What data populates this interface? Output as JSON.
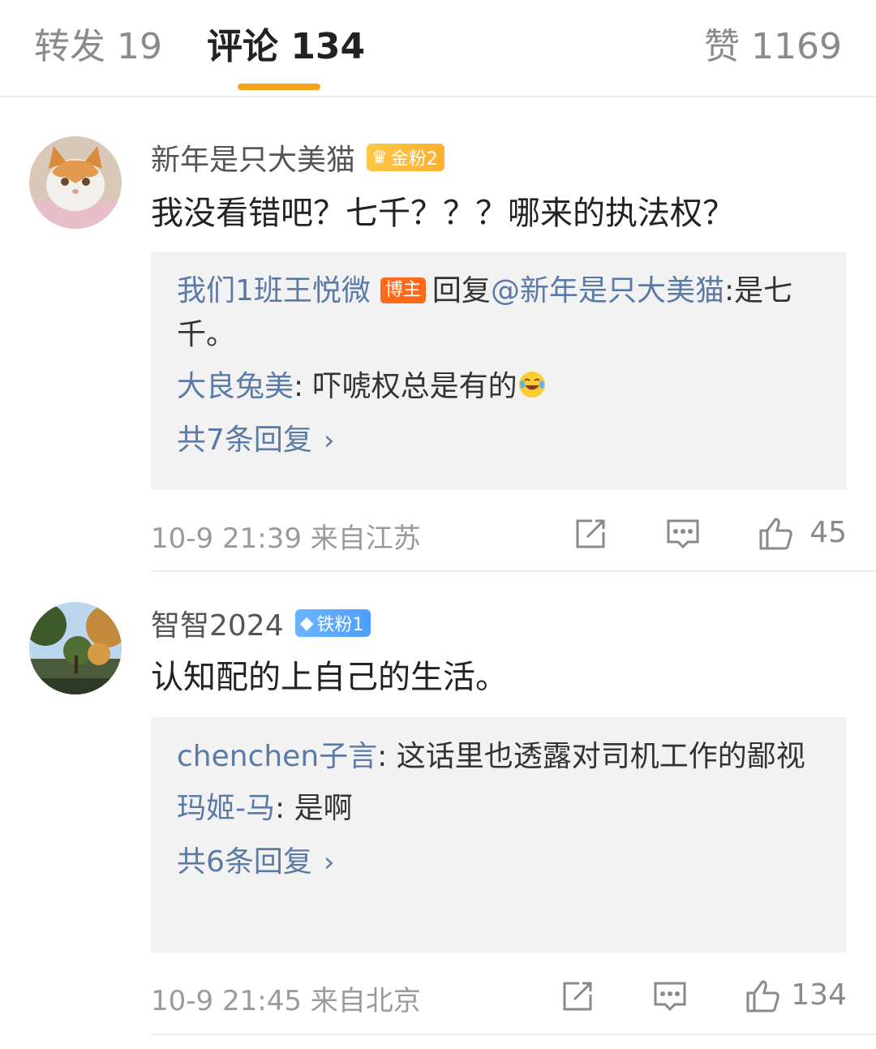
{
  "tabs": {
    "repost": "转发 19",
    "comment": "评论 134",
    "like": "赞 1169"
  },
  "comments": [
    {
      "username": "新年是只大美猫",
      "badge": "金粉2",
      "badge_icon": "crown-icon",
      "text": "我没看错吧？七千？？？哪来的执法权？",
      "replies": [
        {
          "name": "我们1班王悦微",
          "owner_badge": "博主",
          "reply_word": "回复",
          "mention": "@新年是只大美猫",
          "sep": ":",
          "text": "是七千。"
        },
        {
          "name": "大良兔美",
          "sep": ": ",
          "text": "吓唬权总是有的",
          "emoji": "laugh-cry-icon"
        }
      ],
      "more": "共7条回复",
      "time": "10-9 21:39",
      "location": "来自江苏",
      "likes": "45"
    },
    {
      "username": "智智2024",
      "badge": "铁粉1",
      "badge_icon": "diamond-icon",
      "text": "认知配的上自己的生活。",
      "replies": [
        {
          "name": "chenchen子言",
          "sep": ": ",
          "text": "这话里也透露对司机工作的鄙视"
        },
        {
          "name": "玛姬-马",
          "sep": ": ",
          "text": "是啊"
        }
      ],
      "more": "共6条回复",
      "time": "10-9 21:45",
      "location": "来自北京",
      "likes": "134"
    }
  ],
  "colors": {
    "accent": "#f7a21a",
    "link": "#5b7aa5",
    "owner_badge": "#ff6a1a"
  }
}
